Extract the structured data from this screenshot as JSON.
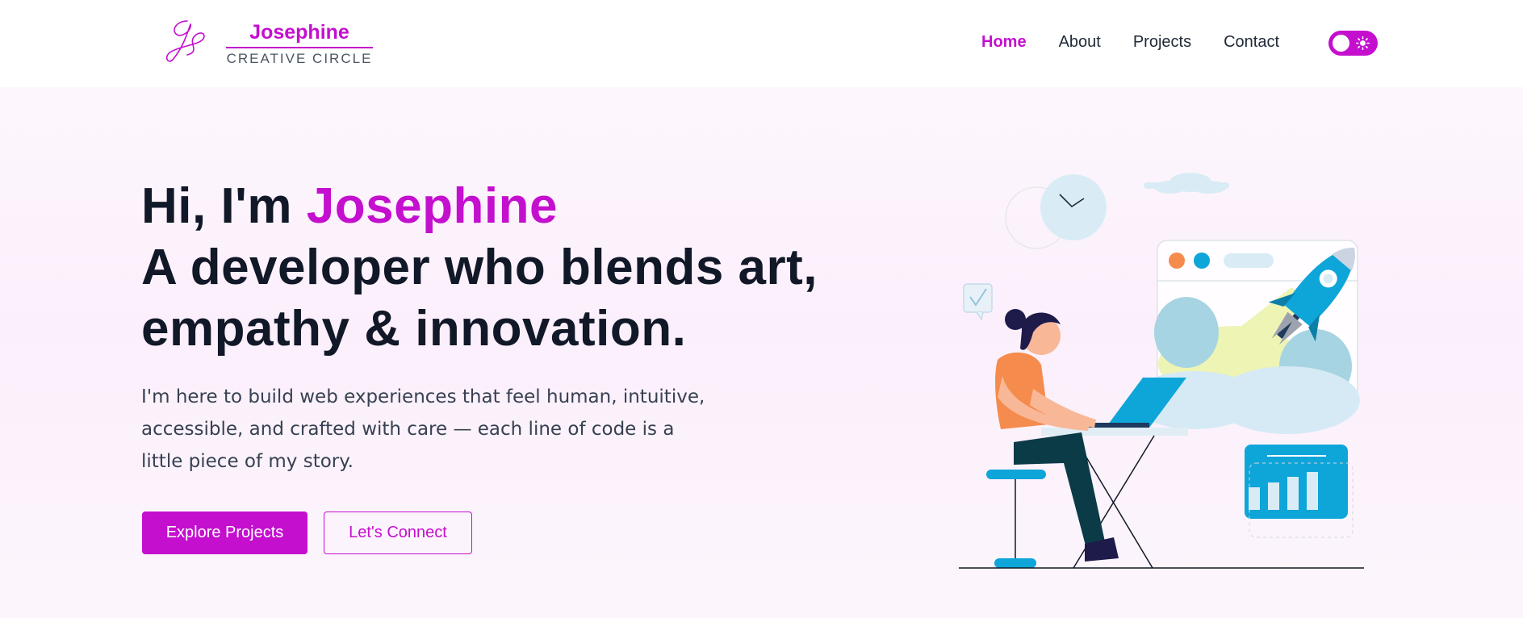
{
  "brand": {
    "name": "Josephine",
    "tagline": "CREATIVE CIRCLE",
    "accent_color": "#c40fcf",
    "logo_icon": "signature-monogram-icon"
  },
  "nav": {
    "items": [
      {
        "label": "Home",
        "active": true
      },
      {
        "label": "About",
        "active": false
      },
      {
        "label": "Projects",
        "active": false
      },
      {
        "label": "Contact",
        "active": false
      }
    ],
    "theme_toggle": {
      "icon": "sun-icon",
      "on": true
    }
  },
  "hero": {
    "greeting": "Hi, I'm ",
    "name": "Josephine",
    "headline_line2": "A developer who blends art,",
    "headline_line3": "empathy & innovation.",
    "intro_line1": "I'm here to build web experiences that feel human, intuitive,",
    "intro_line2": "accessible, and crafted with care — each line of code is a",
    "intro_line3": "little piece of my story.",
    "primary_cta": "Explore Projects",
    "secondary_cta": "Let's Connect",
    "illustration": "developer-at-laptop-with-rocket-launch-illustration"
  }
}
